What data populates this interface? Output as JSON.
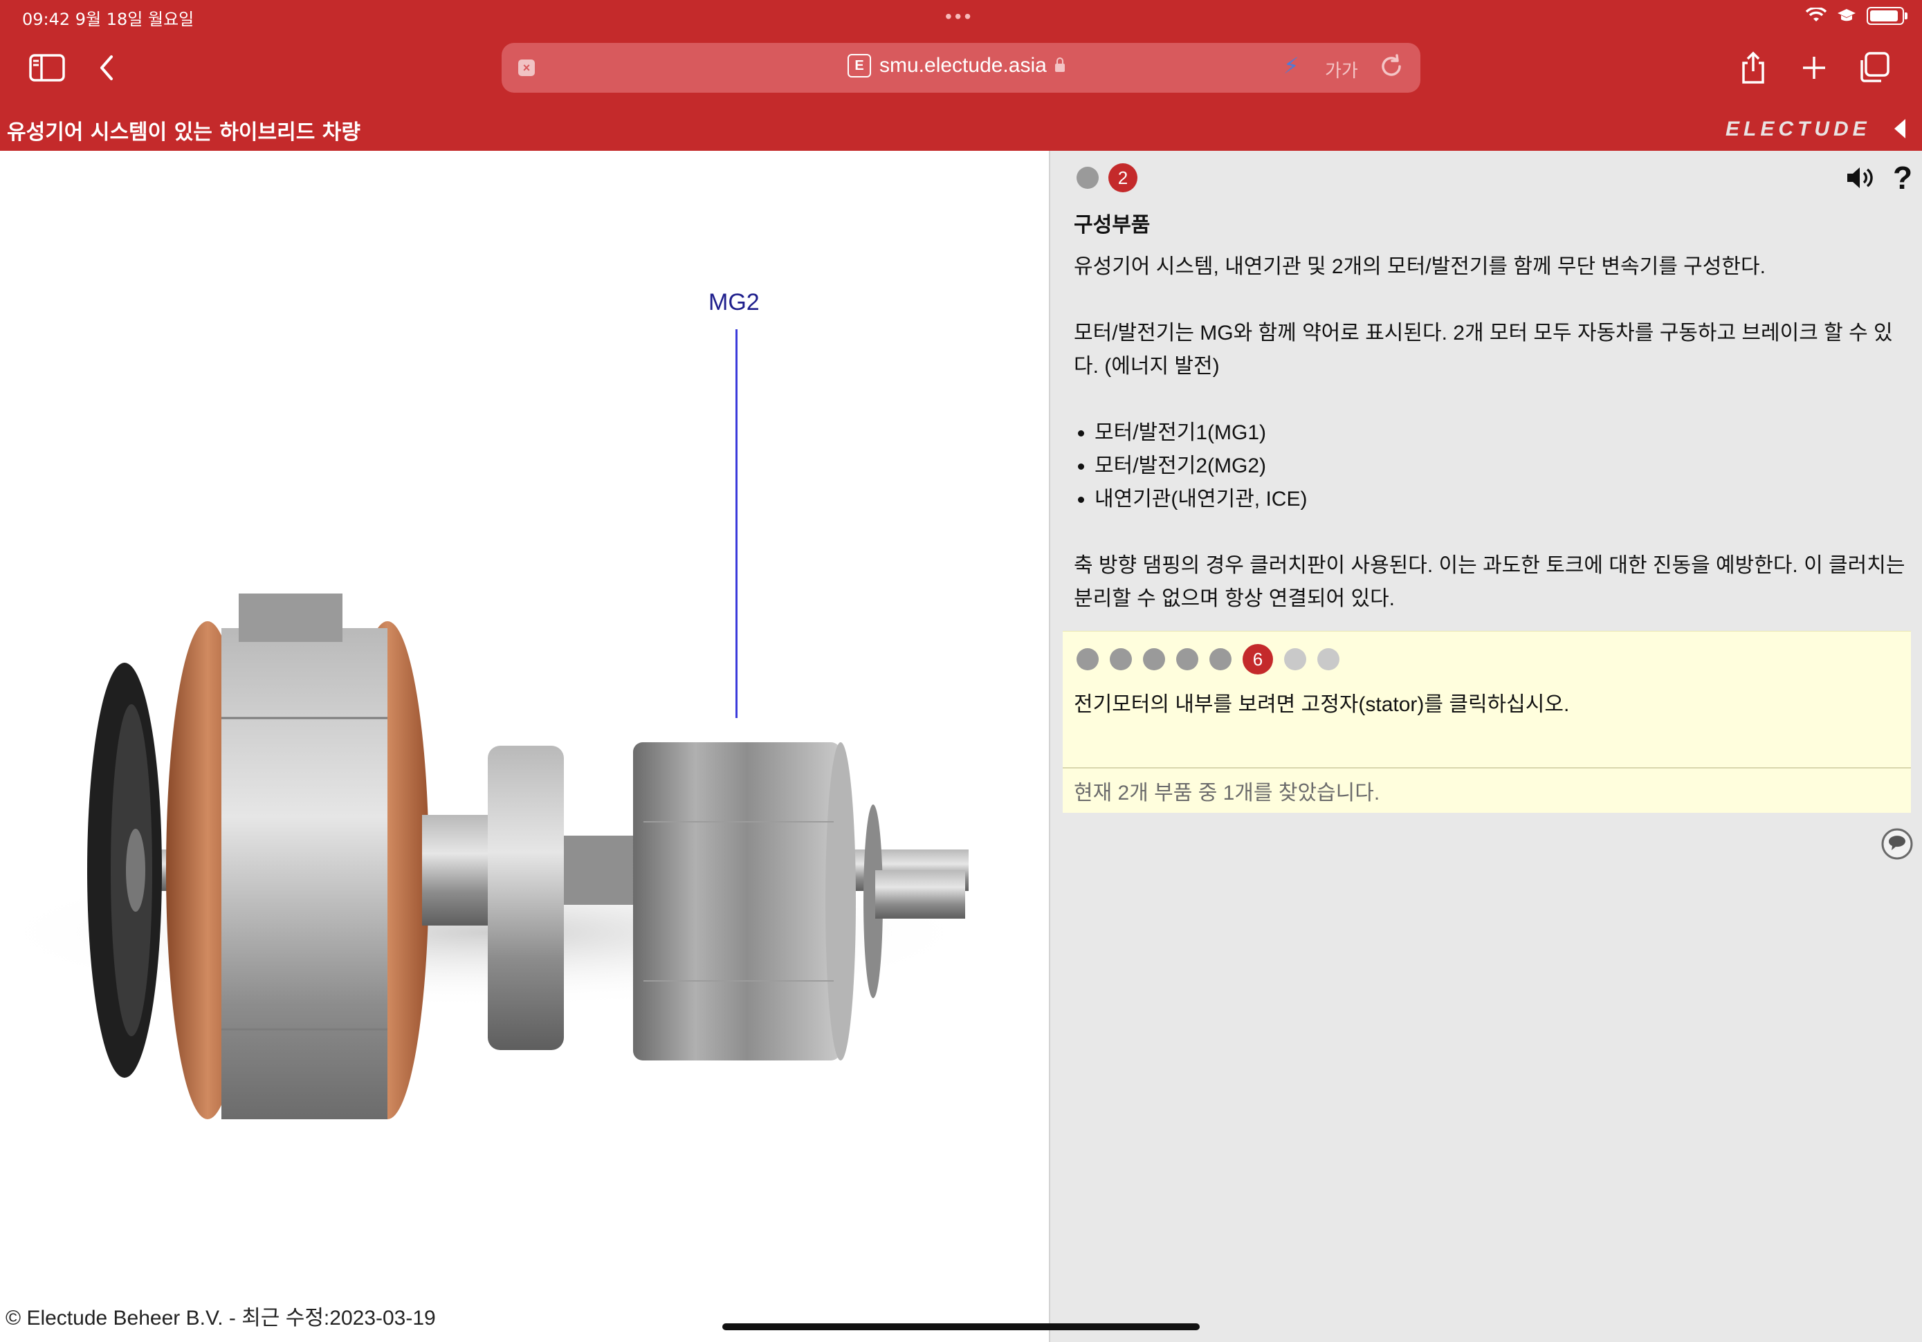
{
  "status_bar": {
    "time_date": "09:42   9월 18일 월요일",
    "dots": "•••"
  },
  "browser": {
    "url": "smu.electude.asia",
    "site_badge": "E",
    "text_size_label": "가가"
  },
  "header": {
    "title": "유성기어 시스템이 있는 하이브리드 차량",
    "brand": "ELECTUDE"
  },
  "image_panel": {
    "callout_label": "MG2",
    "copyright": "© Electude Beheer B.V. - 최근 수정:2023-03-19"
  },
  "info_panel": {
    "active_step": "2",
    "heading": "구성부품",
    "paragraph1": "유성기어 시스템, 내연기관 및 2개의 모터/발전기를 함께 무단 변속기를 구성한다.",
    "paragraph2": "모터/발전기는 MG와 함께 약어로 표시된다. 2개 모터 모두 자동차를 구동하고 브레이크 할 수 있다. (에너지 발전)",
    "list": [
      "모터/발전기1(MG1)",
      "모터/발전기2(MG2)",
      "내연기관(내연기관, ICE)"
    ],
    "paragraph3": "축 방향 댐핑의 경우 클러치판이 사용된다. 이는 과도한 토크에 대한 진동을 예방한다. 이 클러치는 분리할 수 없으며 항상 연결되어 있다."
  },
  "task": {
    "active_step": "6",
    "instruction": "전기모터의 내부를 보려면 고정자(stator)를 클릭하십시오.",
    "status": "현재 2개 부품 중 1개를 찾았습니다."
  },
  "colors": {
    "brand_red": "#c42a2b",
    "panel_gray": "#e8e8e8",
    "task_yellow": "#fffedd"
  },
  "icons": [
    "sidebar-icon",
    "back-chevron-icon",
    "close-tab-icon",
    "lock-icon",
    "feather-icon",
    "reload-icon",
    "share-icon",
    "plus-icon",
    "tabs-icon",
    "speaker-icon",
    "help-icon",
    "chat-bubble-icon",
    "wifi-icon",
    "battery-icon"
  ]
}
